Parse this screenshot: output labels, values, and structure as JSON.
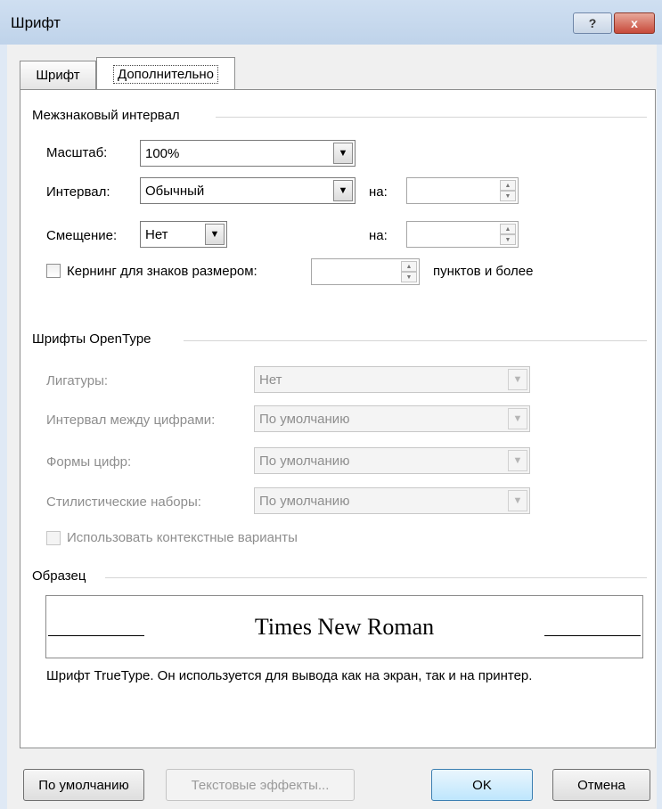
{
  "window": {
    "title": "Шрифт",
    "help_label": "?",
    "close_label": "x"
  },
  "tabs": [
    {
      "label": "Шрифт",
      "selected": false
    },
    {
      "label": "Дополнительно",
      "selected": true
    }
  ],
  "spacing": {
    "group_title": "Межзнаковый интервал",
    "scale_label": "Масштаб:",
    "scale_value": "100%",
    "interval_label": "Интервал:",
    "interval_value": "Обычный",
    "interval_by_label": "на:",
    "interval_by_value": "",
    "offset_label": "Смещение:",
    "offset_value": "Нет",
    "offset_by_label": "на:",
    "offset_by_value": "",
    "kerning_label": "Кернинг для знаков размером:",
    "kerning_checked": false,
    "kerning_value": "",
    "kerning_suffix": "пунктов и более"
  },
  "opentype": {
    "group_title": "Шрифты OpenType",
    "ligatures_label": "Лигатуры:",
    "ligatures_value": "Нет",
    "number_spacing_label": "Интервал между цифрами:",
    "number_spacing_value": "По умолчанию",
    "number_forms_label": "Формы цифр:",
    "number_forms_value": "По умолчанию",
    "stylistic_sets_label": "Стилистические наборы:",
    "stylistic_sets_value": "По умолчанию",
    "contextual_label": "Использовать контекстные варианты",
    "contextual_checked": false
  },
  "preview": {
    "group_title": "Образец",
    "sample_text": "Times New Roman",
    "description": "Шрифт TrueType. Он используется для вывода как на экран, так и на принтер."
  },
  "buttons": {
    "default": "По умолчанию",
    "text_effects": "Текстовые эффекты...",
    "ok": "OK",
    "cancel": "Отмена"
  },
  "colors": {
    "title_bar": "#bfd3ea",
    "close_button": "#c7493a",
    "ok_button": "#bee6fd"
  }
}
